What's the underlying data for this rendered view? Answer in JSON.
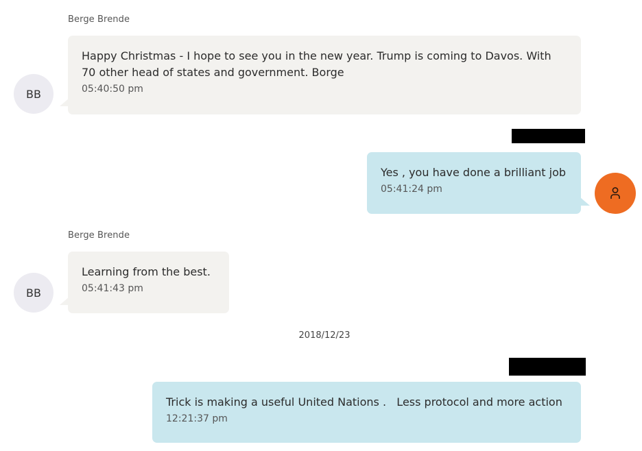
{
  "messages": [
    {
      "sender": "Berge Brende",
      "initials": "BB",
      "text": "Happy Christmas - I hope to see you in the new year. Trump is coming to Davos. With 70 other head of states and government. Borge",
      "time": "05:40:50 pm"
    },
    {
      "text": "Yes , you have done a brilliant job",
      "time": "05:41:24 pm"
    },
    {
      "sender": "Berge Brende",
      "initials": "BB",
      "text": "Learning from the best.",
      "time": "05:41:43 pm"
    },
    {
      "text": "Trick is making a useful United Nations .   Less protocol and more action",
      "time": "12:21:37 pm"
    }
  ],
  "date_separator": "2018/12/23",
  "colors": {
    "incoming_bubble": "#f3f2ef",
    "outgoing_bubble": "#c9e7ee",
    "user_avatar": "#ee6c22",
    "contact_avatar": "#ecebf1"
  },
  "icons": {
    "user_avatar": "user-icon"
  }
}
